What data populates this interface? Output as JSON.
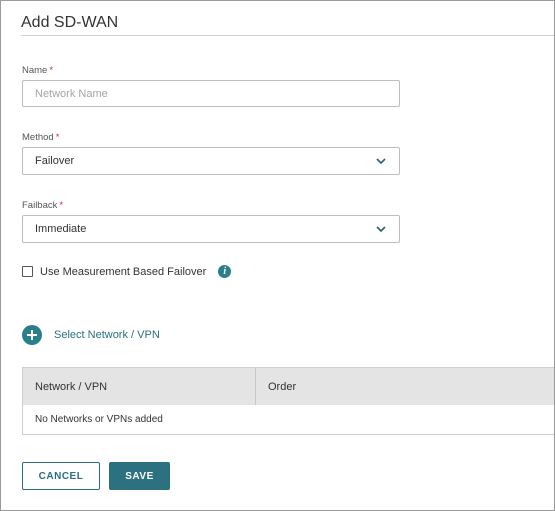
{
  "dialog": {
    "title": "Add SD-WAN"
  },
  "name_field": {
    "label": "Name",
    "required_mark": "*",
    "placeholder": "Network Name",
    "value": ""
  },
  "method_field": {
    "label": "Method",
    "required_mark": "*",
    "selected": "Failover"
  },
  "failback_field": {
    "label": "Failback",
    "required_mark": "*",
    "selected": "Immediate"
  },
  "measurement_option": {
    "label": "Use Measurement Based Failover",
    "checked": false,
    "info_icon": "info-icon"
  },
  "select_network": {
    "label": "Select Network / VPN",
    "icon": "plus-circle-icon"
  },
  "table": {
    "columns": [
      "Network / VPN",
      "Order"
    ],
    "empty_message": "No Networks or VPNs added"
  },
  "buttons": {
    "cancel": "CANCEL",
    "save": "SAVE"
  },
  "colors": {
    "accent": "#2b7f8c",
    "required": "#d32f2f"
  }
}
